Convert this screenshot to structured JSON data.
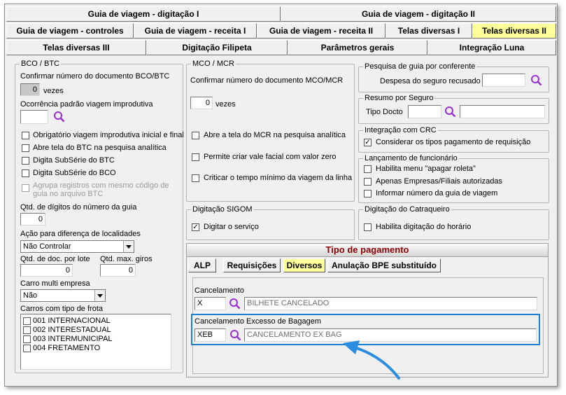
{
  "tabs_row1": [
    "Guia de viagem - digitação I",
    "Guia de viagem - digitação II"
  ],
  "tabs_row2": [
    "Guia de viagem - controles",
    "Guia de viagem - receita I",
    "Guia de viagem - receita II",
    "Telas diversas I",
    "Telas diversas II"
  ],
  "tabs_row3": [
    "Telas diversas III",
    "Digitação Filipeta",
    "Parâmetros gerais",
    "Integração Luna"
  ],
  "bco": {
    "title": "BCO / BTC",
    "confirm_label": "Confirmar  número do documento BCO/BTC",
    "confirm_value": "0",
    "times_label": "vezes",
    "ocorrencia_label": "Ocorrência padrão viagem improdutiva",
    "ocorrencia_value": "",
    "checks": [
      {
        "label": "Obrigatório viagem improdutiva inicial e final",
        "checked": false,
        "disabled": false
      },
      {
        "label": "Abre tela do BTC na pesquisa analítica",
        "checked": false,
        "disabled": false
      },
      {
        "label": "Digita SubSérie do BTC",
        "checked": false,
        "disabled": false
      },
      {
        "label": "Digita SubSérie do BCO",
        "checked": false,
        "disabled": false
      }
    ],
    "agrupa_label1": "Agrupa registros com mesmo código de",
    "agrupa_label2": "guia no arquivo BTC",
    "qtd_digitos_label": "Qtd. de dígitos do número da guia",
    "qtd_digitos_value": "0",
    "acao_label": "Ação para diferença de localidades",
    "acao_value": "Não Controlar",
    "qtd_doc_label": "Qtd. de doc. por lote",
    "qtd_doc_value": "0",
    "qtd_giros_label": "Qtd. max. giros",
    "qtd_giros_value": "0",
    "carro_label": "Carro multi empresa",
    "carro_value": "Não",
    "frota_label": "Carros com tipo de frota",
    "frota_items": [
      "001 INTERNACIONAL",
      "002 INTERESTADUAL",
      "003 INTERMUNICIPAL",
      "004 FRETAMENTO"
    ]
  },
  "mco": {
    "title": "MCO / MCR",
    "confirm_label": "Confirmar  número do documento MCO/MCR",
    "confirm_value": "0",
    "times_label": "vezes",
    "checks": [
      {
        "label": "Abre a tela do MCR na pesquisa analítica",
        "checked": false
      },
      {
        "label": "Permite criar vale facial com valor zero",
        "checked": false
      },
      {
        "label": "Criticar o tempo mínimo da viagem da linha",
        "checked": false
      }
    ]
  },
  "pesquisa": {
    "title": "Pesquisa de guia por conferente",
    "label": "Despesa do seguro recusado",
    "value": ""
  },
  "resumo": {
    "title": "Resumo por Seguro",
    "label": "Tipo Docto",
    "code": "",
    "desc": ""
  },
  "crc": {
    "title": "Integração com CRC",
    "label": "Considerar os tipos pagamento de requisição",
    "checked": true
  },
  "lancamento": {
    "title": "Lançamento de funcionário",
    "checks": [
      {
        "label": "Habilita menu \"apagar roleta\"",
        "checked": false
      },
      {
        "label": "Apenas Empresas/Filiais autorizadas",
        "checked": false
      },
      {
        "label": "Informar número da guia de viagem",
        "checked": false
      }
    ]
  },
  "sigom": {
    "title": "Digitação SIGOM",
    "label": "Digitar o serviço",
    "checked": true
  },
  "catraqueiro": {
    "title": "Digitação do Catraqueiro",
    "label": "Habilita digitação do horário",
    "checked": false
  },
  "pagamento": {
    "title": "Tipo de pagamento",
    "tabs": [
      "ALP",
      "Requisições",
      "Diversos",
      "Anulação BPE substituído"
    ],
    "cancelamento_label": "Cancelamento",
    "cancelamento_code": "X",
    "cancelamento_desc": "BILHETE CANCELADO",
    "excesso_label": "Cancelamento Excesso de Bagagem",
    "excesso_code": "XEB",
    "excesso_desc": "CANCELAMENTO EX BAG"
  },
  "colors": {
    "active_tab": "#ffff99",
    "header_title": "#8b0000",
    "highlight": "#1a7fd6",
    "icon": "#9b30d0"
  }
}
